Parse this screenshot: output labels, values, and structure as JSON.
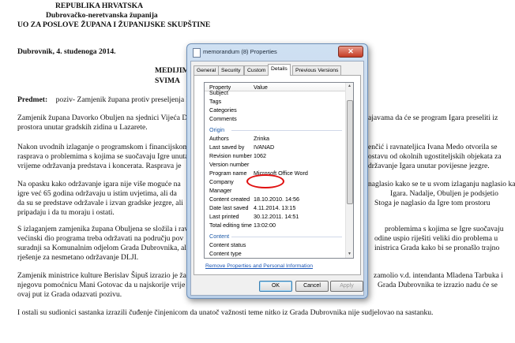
{
  "document": {
    "header_1": "REPUBLIKA HRVATSKA",
    "header_2": "Dubrovačko-neretvanska županija",
    "header_3": "UO ZA POSLOVE ŽUPANA I ŽUPANIJSKE SKUPŠTINE",
    "dateline": "Dubrovnik,  4. studenoga 2014.",
    "recipient_1": "MEDIJIM",
    "recipient_2": "SVIMA",
    "subject_label": "Predmet:",
    "subject_text": "poziv- Zamjenik župana protiv preseljenja I",
    "p1_l1": "Zamjenik župana Davorko Obuljen na sjednici Vijeća D",
    "p1_l1_right": "ajavama da će se program Igara preseliti iz",
    "p1_l2": "prostora unutar gradskih zidina u Lazarete.",
    "p2_l1": "Nakon uvodnih izlaganje o programskom i financijskom",
    "p2_l1_right": "enčić i ravnateljica Ivana Medo otvorila se",
    "p2_l2": "rasprava o problemima s kojima se suočavaju Igre unutar",
    "p2_l2_right": "ostavu od okolnih ugostiteljskih objekata za",
    "p2_l3": "vrijeme održavanja predstava i koncerata. Rasprava je",
    "p2_l3_right": "državanje Igara unutar povijesne jezgre.",
    "p3_l1": "Na opasku kako održavanje igara nije više moguće na",
    "p3_l1_right": "naglasio kako se te  u svom izlaganju naglasio kako se",
    "p3_l2": "igre već 65 godina održavaju u istim uvjetima, ali da",
    "p3_l2_right": "Igara. Nadalje, Obuljen je podsjetio",
    "p3_l3": "da su se predstave održavale i izvan gradske jezgre, ali",
    "p3_l3_right": "Stoga je naglasio da Igre tom prostoru",
    "p3_l4": "pripadaju i da tu moraju i ostati.",
    "p4_l1": "S izlaganjem zamjenika župana Obuljena se složila i ravn",
    "p4_l1_right": "problemima s kojima se Igre suočavaju",
    "p4_l2": "većinski dio programa treba održavati na području pov",
    "p4_l2_right": "odine uspio riješiti veliki dio problema u",
    "p4_l3": "suradnji sa Komunalnim odjelom Grada Dubrovnika, al",
    "p4_l3_right": "inistrica Grada kako bi se pronašlo trajno",
    "p4_l4": "rješenje za nesmetano održavanje DLJI.",
    "p5_l1": "Zamjenik ministrice kulture Berislav Šipuš izrazio je žal",
    "p5_l1_right": "zamolio v.d. intendanta Mladena Tarbuka i",
    "p5_l2": "njegovu pomoćnicu Mani Gotovac da u najskorije vrije",
    "p5_l2_right": "Grada Dubrovnika te izrazio nadu će se",
    "p5_l3": "ovaj put iz Grada odazvati pozivu.",
    "p6": "I ostali su sudionici sastanka izrazili čuđenje činjenicom da unatoč važnosti teme nitko iz Grada Dubrovnika nije sudjelovao na sastanku."
  },
  "dialog": {
    "title": "memorandum (8) Properties",
    "close_label": "✕",
    "tabs": [
      "General",
      "Security",
      "Custom",
      "Details",
      "Previous Versions"
    ],
    "active_tab": "Details",
    "columns": {
      "property": "Property",
      "value": "Value"
    },
    "rows_top": [
      {
        "k": "Subject",
        "v": ""
      },
      {
        "k": "Tags",
        "v": ""
      },
      {
        "k": "Categories",
        "v": ""
      },
      {
        "k": "Comments",
        "v": ""
      }
    ],
    "group_origin": "Origin",
    "rows_origin": [
      {
        "k": "Authors",
        "v": "Zrinka"
      },
      {
        "k": "Last saved by",
        "v": "IVANAD"
      },
      {
        "k": "Revision number",
        "v": "1062"
      },
      {
        "k": "Version number",
        "v": ""
      },
      {
        "k": "Program name",
        "v": "Microsoft Office Word"
      },
      {
        "k": "Company",
        "v": ""
      },
      {
        "k": "Manager",
        "v": ""
      },
      {
        "k": "Content created",
        "v": "18.10.2010. 14:56"
      },
      {
        "k": "Date last saved",
        "v": "4.11.2014. 13:15"
      },
      {
        "k": "Last printed",
        "v": "30.12.2011. 14:51"
      },
      {
        "k": "Total editing time",
        "v": "13:02:00"
      }
    ],
    "group_content": "Content",
    "rows_content": [
      {
        "k": "Content status",
        "v": ""
      },
      {
        "k": "Content type",
        "v": ""
      }
    ],
    "remove_link": "Remove Properties and Personal Information",
    "buttons": {
      "ok": "OK",
      "cancel": "Cancel",
      "apply": "Apply"
    },
    "highlight_color": "#e01010"
  }
}
